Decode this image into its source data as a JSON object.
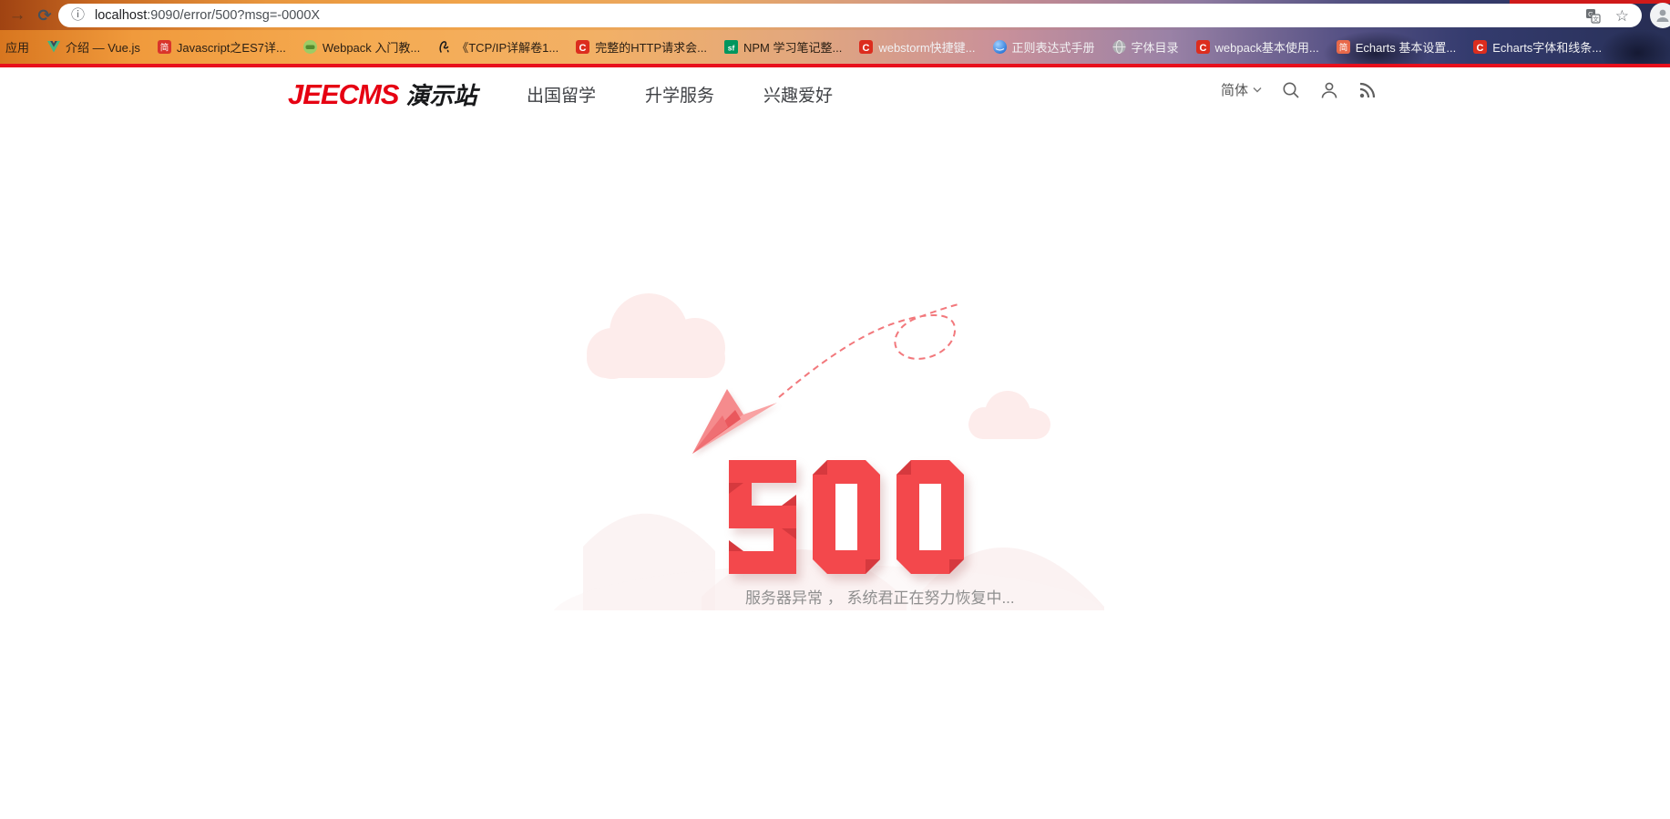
{
  "browser": {
    "toolbar": {
      "forward_glyph": "→",
      "reload_glyph": "⟳",
      "info_glyph": "ⓘ",
      "star_glyph": "☆",
      "url_host": "localhost",
      "url_rest": ":9090/error/500?msg=-0000X"
    },
    "bookmarks": [
      {
        "label": "应用",
        "icon": "none",
        "tone": "dark"
      },
      {
        "label": "介绍 — Vue.js",
        "icon": "vue",
        "tone": "dark"
      },
      {
        "label": "Javascript之ES7详...",
        "icon": "jianshu",
        "tone": "dark"
      },
      {
        "label": "Webpack 入门教...",
        "icon": "webpack",
        "tone": "dark"
      },
      {
        "label": "《TCP/IP详解卷1...",
        "icon": "signature",
        "tone": "dark"
      },
      {
        "label": "完整的HTTP请求会...",
        "icon": "csdn",
        "tone": "dark"
      },
      {
        "label": "NPM 学习笔记整...",
        "icon": "segmentfault",
        "tone": "dark"
      },
      {
        "label": "webstorm快捷键...",
        "icon": "csdn",
        "tone": "light"
      },
      {
        "label": "正则表达式手册",
        "icon": "globe-blue",
        "tone": "light"
      },
      {
        "label": "字体目录",
        "icon": "globe",
        "tone": "light"
      },
      {
        "label": "webpack基本使用...",
        "icon": "csdn",
        "tone": "light"
      },
      {
        "label": "Echarts 基本设置...",
        "icon": "jianshu-orange",
        "tone": "light"
      },
      {
        "label": "Echarts字体和线条...",
        "icon": "csdn",
        "tone": "light"
      }
    ]
  },
  "header": {
    "logo_primary": "JEECMS",
    "logo_secondary": "演示站",
    "nav": [
      "出国留学",
      "升学服务",
      "兴趣爱好"
    ],
    "language": "简体"
  },
  "error": {
    "code": "500",
    "message": "服务器异常 ， 系统君正在努力恢复中..."
  },
  "colors": {
    "accent_red": "#e60012",
    "origami_red": "#f3484c",
    "origami_dark": "#d6393e",
    "plane_light": "#f9a2a3",
    "plane_mid": "#f58b8d",
    "plane_dark": "#ea585d",
    "trail_red": "#f2787c",
    "cloud_pink": "#fdeceb",
    "message_gray": "#8f8f8f"
  }
}
